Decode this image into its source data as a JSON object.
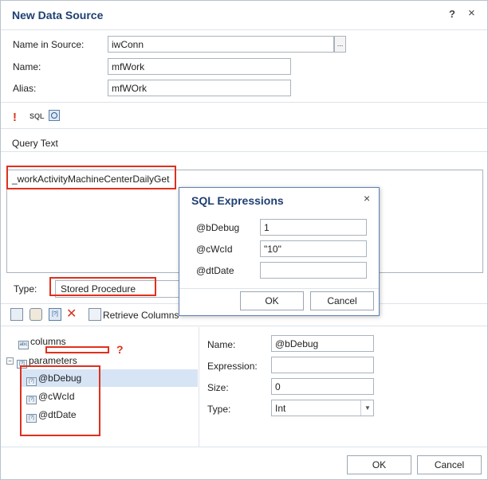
{
  "dialog": {
    "title": "New Data Source",
    "help_label": "?",
    "close_label": "×"
  },
  "form": {
    "name_in_source_label": "Name in Source:",
    "name_in_source_value": "iwConn",
    "browse_label": "...",
    "name_label": "Name:",
    "name_value": "mfWork",
    "alias_label": "Alias:",
    "alias_value": "mfWOrk"
  },
  "toolbar": {
    "exclaim_icon": "!",
    "sql_icon": "SQL",
    "query_icon": "query-icon"
  },
  "query": {
    "label": "Query Text",
    "text": "_workActivityMachineCenterDailyGet"
  },
  "type": {
    "label": "Type:",
    "value": "Stored Procedure"
  },
  "toolbar2": {
    "retrieve_label": "Retrieve Columns"
  },
  "tree": {
    "columns_label": "columns",
    "parameters_label": "parameters",
    "expander": "−",
    "question_mark": "?",
    "params": [
      "@bDebug",
      "@cWcId",
      "@dtDate"
    ]
  },
  "properties": {
    "name_label": "Name:",
    "name_value": "@bDebug",
    "expression_label": "Expression:",
    "expression_value": "",
    "size_label": "Size:",
    "size_value": "0",
    "type_label": "Type:",
    "type_value": "Int"
  },
  "buttons": {
    "ok": "OK",
    "cancel": "Cancel"
  },
  "sql_expressions": {
    "title": "SQL Expressions",
    "close_label": "×",
    "rows": [
      {
        "label": "@bDebug",
        "value": "1"
      },
      {
        "label": "@cWcId",
        "value": "\"10\""
      },
      {
        "label": "@dtDate",
        "value": ""
      }
    ],
    "ok": "OK",
    "cancel": "Cancel"
  },
  "colors": {
    "title": "#1f3f72",
    "highlight": "#e0301e",
    "selection": "#d6e4f5"
  }
}
